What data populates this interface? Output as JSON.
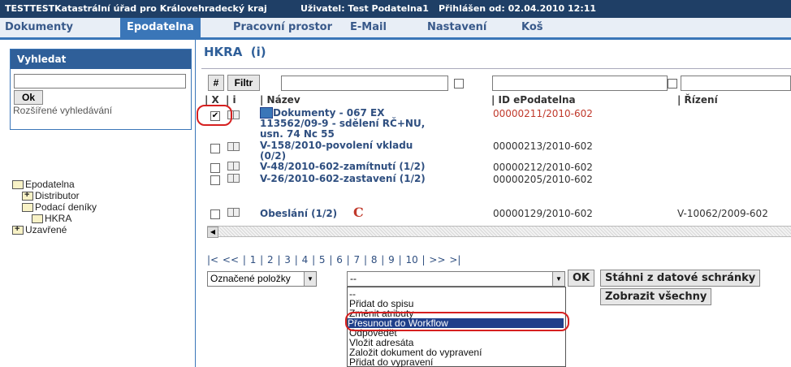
{
  "titlebar": {
    "org": "TESTTESTKatastrální úřad pro Královehradecký kraj",
    "user": "Uživatel: Test Podatelna1",
    "login": "Přihlášen od: 02.04.2010 12:11"
  },
  "menu": [
    "Dokumenty",
    "Epodatelna",
    "Pracovní prostor",
    "E-Mail",
    "Nastavení",
    "Koš"
  ],
  "menu_active_index": 1,
  "sidebar": {
    "search_title": "Vyhledat",
    "search_value": "",
    "ok_label": "Ok",
    "advanced_link": "Rozšířené vyhledávání",
    "tree": {
      "root": "Epodatelna",
      "distributor": "Distributor",
      "podaci": "Podací deníky",
      "hkra": "HKRA",
      "uzavrene": "Uzavřené"
    }
  },
  "main": {
    "heading": "HKRA",
    "heading_info": "(i)",
    "hash_label": "#",
    "filter_label": "Filtr",
    "columns": {
      "x": "| X",
      "i": "| i",
      "name": "| Název",
      "id": "| ID ePodatelna",
      "rizeni": "| Řízení"
    },
    "rows": [
      {
        "name_lines": [
          "Dokumenty - 067 EX",
          "113562/09-9 - sdělení RČ+NU,",
          "usn. 74 Nc 55"
        ],
        "id": "00000211/2010-602",
        "rizeni": "",
        "checked": true,
        "id_red": true
      },
      {
        "name_lines": [
          "V-158/2010-povolení vkladu",
          "(0/2)"
        ],
        "id": "00000213/2010-602",
        "rizeni": "",
        "checked": false,
        "id_red": false
      },
      {
        "name_lines": [
          "V-48/2010-602-zamítnutí (1/2)"
        ],
        "id": "00000212/2010-602",
        "rizeni": "",
        "checked": false,
        "id_red": false
      },
      {
        "name_lines": [
          "V-26/2010-602-zastavení (1/2)"
        ],
        "id": "00000205/2010-602",
        "rizeni": "",
        "checked": false,
        "id_red": false
      },
      {
        "name_lines": [
          "Obeslání (1/2)"
        ],
        "id": "00000129/2010-602",
        "rizeni": "V-10062/2009-602",
        "checked": false,
        "id_red": false
      }
    ],
    "pager": "|<  <<  | 1 | 2 | 3 | 4 | 5 | 6 | 7 | 8 | 9 | 10 |  >>  >|",
    "bulk_select": "Označené položky",
    "action_select": "--",
    "ok_label": "OK",
    "download_label": "Stáhni z datové schránky",
    "show_all_label": "Zobrazit všechny",
    "dropdown_options": [
      "--",
      "Přidat do spisu",
      "Změnit atributy",
      "Přesunout do Workflow",
      "Odpovědět",
      "Vložit adresáta",
      "Založit dokument do vypravení",
      "Přidat do vypravení"
    ],
    "dropdown_selected_index": 3
  },
  "colors": {
    "titlebar_bg": "#1f3f66",
    "accent": "#3a76b8",
    "link": "#2f4f80",
    "highlight": "#d62020",
    "id_red": "#c0392b"
  }
}
